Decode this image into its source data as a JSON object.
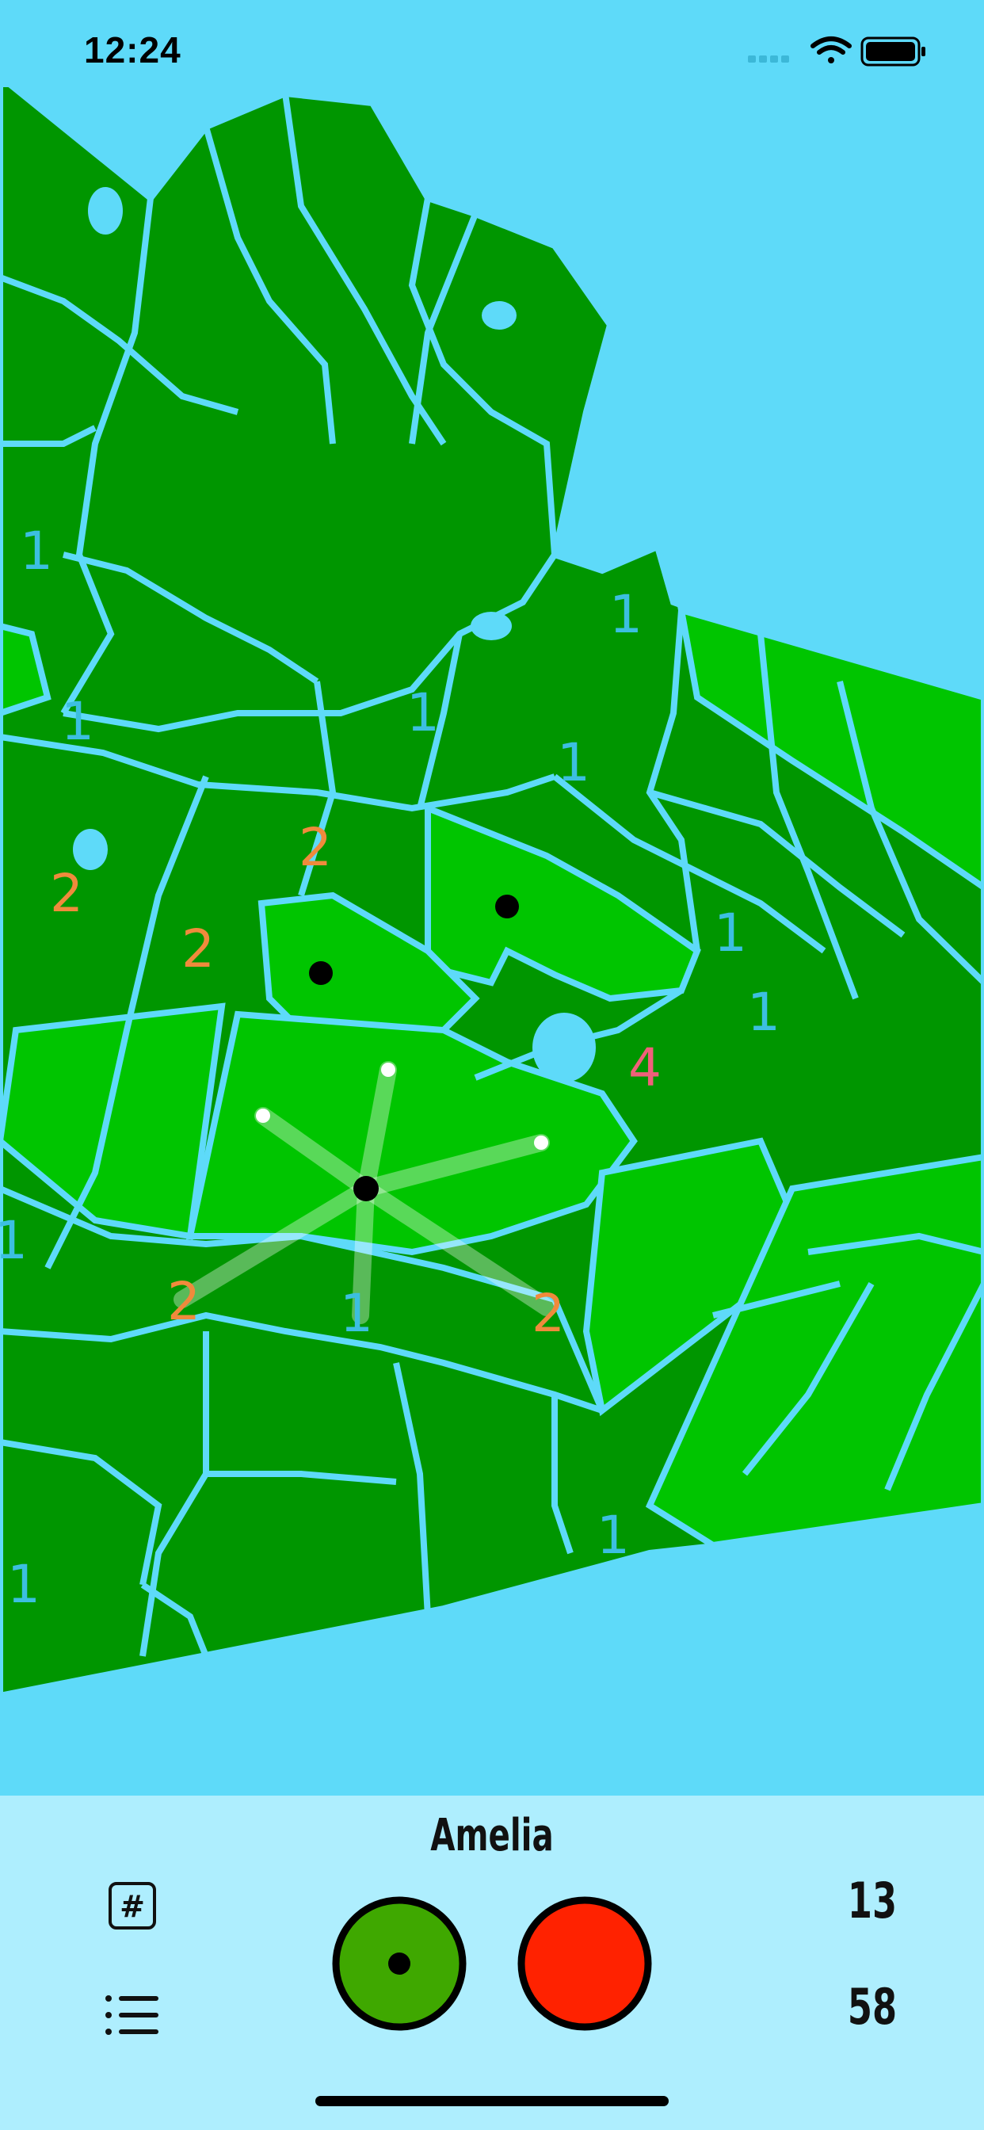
{
  "status_bar": {
    "time": "12:24",
    "icons": [
      "signal-icon",
      "wifi-icon",
      "battery-icon"
    ]
  },
  "board": {
    "land_color_dark": "#009600",
    "land_color_light": "#00c500",
    "border_color": "#5edaf9",
    "region_counts": [
      {
        "label": "1",
        "color": "#3cbfe0"
      },
      {
        "label": "1",
        "color": "#3cbfe0"
      },
      {
        "label": "1",
        "color": "#3cbfe0"
      },
      {
        "label": "1",
        "color": "#3cbfe0"
      },
      {
        "label": "1",
        "color": "#3cbfe0"
      },
      {
        "label": "2",
        "color": "#f08a3c"
      },
      {
        "label": "2",
        "color": "#f08a3c"
      },
      {
        "label": "2",
        "color": "#f08a3c"
      },
      {
        "label": "1",
        "color": "#3cbfe0"
      },
      {
        "label": "1",
        "color": "#3cbfe0"
      },
      {
        "label": "4",
        "color": "#f0607a"
      },
      {
        "label": "1",
        "color": "#3cbfe0"
      },
      {
        "label": "2",
        "color": "#f08a3c"
      },
      {
        "label": "1",
        "color": "#3cbfe0"
      },
      {
        "label": "2",
        "color": "#f08a3c"
      },
      {
        "label": "1",
        "color": "#3cbfe0"
      },
      {
        "label": "1",
        "color": "#3cbfe0"
      }
    ]
  },
  "panel": {
    "player_name": "Amelia",
    "stat_top": "13",
    "stat_bottom": "58",
    "hash_label": "#",
    "player_color": "#3fa800",
    "opponent_color": "#ff2200"
  }
}
